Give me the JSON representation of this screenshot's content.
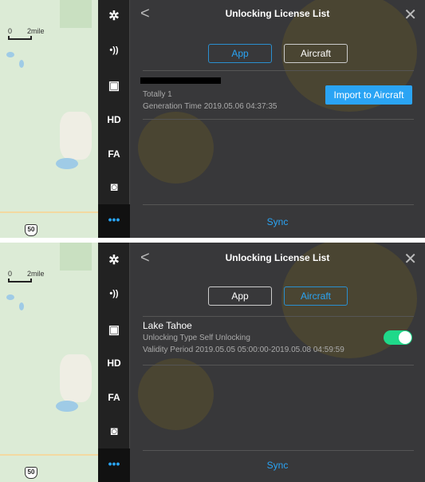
{
  "map": {
    "scale_zero": "0",
    "scale_label": "2mile",
    "route_shield": "50"
  },
  "sidebar": {
    "items": [
      {
        "icon": "aircraft-icon",
        "glyph": "✲"
      },
      {
        "icon": "signal-icon",
        "glyph": "•))"
      },
      {
        "icon": "remote-controller-icon",
        "glyph": "▣"
      },
      {
        "icon": "hd-icon",
        "glyph": "HD"
      },
      {
        "icon": "fa-icon",
        "glyph": "FA"
      },
      {
        "icon": "camera-icon",
        "glyph": "◙"
      },
      {
        "icon": "more-icon",
        "glyph": "•••"
      }
    ]
  },
  "panel1": {
    "title": "Unlocking License List",
    "tabs": [
      {
        "label": "App",
        "active": true
      },
      {
        "label": "Aircraft",
        "active": false
      }
    ],
    "totally": "Totally 1",
    "generation_time": "Generation Time  2019.05.06 04:37:35",
    "import_button": "Import to Aircraft",
    "sync": "Sync"
  },
  "panel2": {
    "title": "Unlocking License List",
    "tabs": [
      {
        "label": "App",
        "active": false
      },
      {
        "label": "Aircraft",
        "active": true
      }
    ],
    "license_name": "Lake Tahoe",
    "unlocking_type": "Unlocking Type  Self Unlocking",
    "validity_period": "Validity Period  2019.05.05 05:00:00-2019.05.08 04:59:59",
    "toggle_on": true,
    "sync": "Sync"
  },
  "colors": {
    "accent": "#2aa4f4",
    "toggle": "#1fd98a"
  }
}
